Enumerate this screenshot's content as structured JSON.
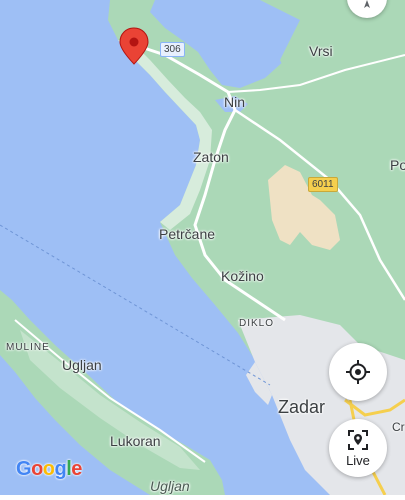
{
  "map": {
    "colors": {
      "water": "#8ab4f8",
      "land": "#ffffff",
      "green": "#a8dab5",
      "urban": "#e6e8eb",
      "sand": "#f1e4c8",
      "road": "#ffffff"
    },
    "places": {
      "vrsi": "Vrsi",
      "nin": "Nin",
      "zaton": "Zaton",
      "petrcane": "Petrčane",
      "kozino": "Kožino",
      "diklo": "DIKLO",
      "muline": "MULINE",
      "ugljan_town": "Ugljan",
      "lukoran": "Lukoran",
      "ugljan_island": "Ugljan",
      "zadar": "Zadar",
      "po_partial": "Po",
      "cr_partial": "Cr"
    },
    "roads": {
      "road_306": "306",
      "road_6011": "6011"
    },
    "marker": {
      "icon": "location-pin-icon",
      "color": "#ea4335"
    }
  },
  "controls": {
    "recenter_icon": "my-location-icon",
    "live_icon": "live-view-icon",
    "live_label": "Live",
    "top_button_icon": "compass-icon"
  },
  "branding": {
    "logo_text": "Google",
    "logo_colors": [
      "#4285f4",
      "#ea4335",
      "#fbbc05",
      "#4285f4",
      "#34a853",
      "#ea4335"
    ]
  }
}
